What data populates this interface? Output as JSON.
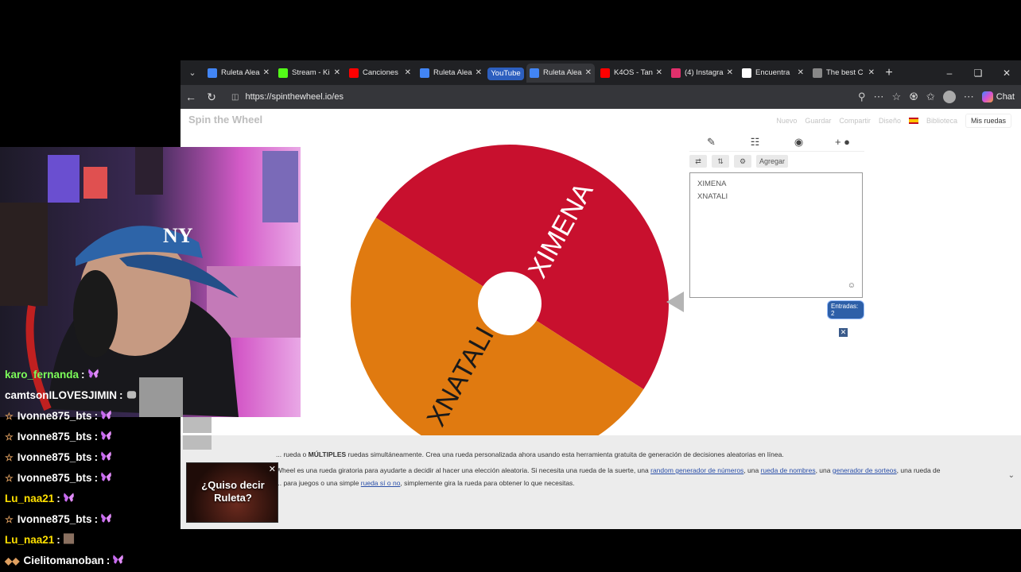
{
  "browser": {
    "tabs": [
      {
        "title": "Ruleta Alea",
        "color": "#4285f4"
      },
      {
        "title": "Stream - Ki",
        "color": "#53fc18"
      },
      {
        "title": "Canciones",
        "color": "#ff0000"
      },
      {
        "title": "Ruleta Alea",
        "color": "#4285f4"
      },
      {
        "title": "YouTube",
        "color": "#2d5fbf"
      },
      {
        "title": "Ruleta Alea",
        "color": "#4285f4"
      },
      {
        "title": "K4OS - Tan",
        "color": "#ff0000"
      },
      {
        "title": "(4) Instagra",
        "color": "#e1306c"
      },
      {
        "title": "Encuentra",
        "color": "#ffffff"
      },
      {
        "title": "The best C",
        "color": "#888888"
      }
    ],
    "url": "https://spinthewheel.io/es",
    "chat_label": "Chat"
  },
  "site": {
    "logo": "Spin the Wheel",
    "nav": [
      "Nuevo",
      "Guardar",
      "Compartir",
      "Diseño",
      "Biblioteca"
    ],
    "mis_ruedas": "Mis ruedas",
    "add_button": "Agregar",
    "entries": [
      "XIMENA",
      "XNATALI"
    ],
    "entries_count": "Entradas: 2",
    "description_line1_pre": "... rueda o ",
    "description_line1_bold": "MÚLTIPLES",
    "description_line1_post": " ruedas simultáneamente. Crea una rueda personalizada ahora usando esta herramienta gratuita de generación de decisiones aleatorias en línea.",
    "description_line2_pre": "Wheel es una rueda giratoria para ayudarte a decidir al hacer una elección aleatoria. Si necesita una rueda de la suerte, una ",
    "description_link1": "random generador de números",
    "description_line2_mid1": ", una ",
    "description_link2": "rueda de nombres",
    "description_line2_mid2": ", una ",
    "description_link3": "generador de sorteos",
    "description_line2_post": ", una rueda de",
    "description_line3_pre": "... para juegos o una simple ",
    "description_link4": "rueda sí o no",
    "description_line3_post": ", simplemente gira la rueda para obtener lo que necesitas."
  },
  "wheel": {
    "segments": [
      {
        "label": "XIMENA",
        "color": "#c8102e"
      },
      {
        "label": "XNATALI",
        "color": "#e07a10"
      }
    ]
  },
  "chat": [
    {
      "user": "karo_fernanda",
      "color": "#7cfc5a",
      "badge": "",
      "emote": "butterfly"
    },
    {
      "user": "camtsonILOVESJIMIN",
      "color": "#ffffff",
      "badge": "",
      "emote": "cat"
    },
    {
      "user": "Ivonne875_bts",
      "color": "#ffffff",
      "badge": "☆",
      "emote": "butterfly"
    },
    {
      "user": "Ivonne875_bts",
      "color": "#ffffff",
      "badge": "☆",
      "emote": "butterfly"
    },
    {
      "user": "Ivonne875_bts",
      "color": "#ffffff",
      "badge": "☆",
      "emote": "butterfly"
    },
    {
      "user": "Ivonne875_bts",
      "color": "#ffffff",
      "badge": "☆",
      "emote": "butterfly"
    },
    {
      "user": "Lu_naa21",
      "color": "#ffe000",
      "badge": "",
      "emote": "butterfly"
    },
    {
      "user": "Ivonne875_bts",
      "color": "#ffffff",
      "badge": "☆",
      "emote": "butterfly"
    },
    {
      "user": "Lu_naa21",
      "color": "#ffe000",
      "badge": "",
      "emote": "face"
    },
    {
      "user": "Cielitomanoban",
      "color": "#ffffff",
      "badge": "◆◆",
      "emote": "butterfly"
    }
  ],
  "popup": {
    "line1": "¿Quiso decir",
    "line2": "Ruleta?"
  }
}
